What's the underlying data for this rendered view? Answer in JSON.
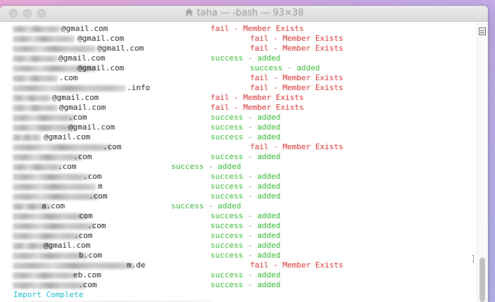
{
  "window": {
    "title": "taha — -bash — 93×38"
  },
  "terminal": {
    "rows": [
      {
        "email": "@gmail.com",
        "status": "fail - Member Exists",
        "kind": "fail"
      },
      {
        "email": "@gmail.com",
        "status": "fail - Member Exists",
        "kind": "fail"
      },
      {
        "email": "@gmail.com",
        "status": "fail - Member Exists",
        "kind": "fail"
      },
      {
        "email": "@gmail.com",
        "status": "success - added",
        "kind": "ok"
      },
      {
        "email": "@gmail.com",
        "status": "success - added",
        "kind": "ok"
      },
      {
        "email": ".com",
        "status": "fail - Member Exists",
        "kind": "fail"
      },
      {
        "email": ".info",
        "status": "fail - Member Exists",
        "kind": "fail"
      },
      {
        "email": "@gmail.com",
        "status": "fail - Member Exists",
        "kind": "fail"
      },
      {
        "email": "@gmail.com",
        "status": "fail - Member Exists",
        "kind": "fail"
      },
      {
        "email": ".com",
        "status": "success - added",
        "kind": "ok"
      },
      {
        "email": "@gmail.com",
        "status": "success - added",
        "kind": "ok"
      },
      {
        "email": "@gmail.com",
        "status": "success - added",
        "kind": "ok"
      },
      {
        "email": ".com",
        "status": "fail - Member Exists",
        "kind": "fail"
      },
      {
        "email": ".com",
        "status": "success - added",
        "kind": "ok"
      },
      {
        "email": ".com",
        "status": "success - added",
        "kind": "ok"
      },
      {
        "email": ".com",
        "status": "success - added",
        "kind": "ok"
      },
      {
        "email": "m",
        "status": "success - added",
        "kind": "ok"
      },
      {
        "email": ".com",
        "status": "success - added",
        "kind": "ok"
      },
      {
        "email": "a.com",
        "status": "success - added",
        "kind": "ok"
      },
      {
        "email": "com",
        "status": "success - added",
        "kind": "ok"
      },
      {
        "email": ".com",
        "status": "success - added",
        "kind": "ok"
      },
      {
        "email": ".com",
        "status": "success - added",
        "kind": "ok"
      },
      {
        "email": "@gmail.com",
        "status": "success - added",
        "kind": "ok"
      },
      {
        "email": "b.com",
        "status": "success - added",
        "kind": "ok"
      },
      {
        "email": "m.de",
        "status": "fail - Member Exists",
        "kind": "fail"
      },
      {
        "email": "eb.com",
        "status": "success - added",
        "kind": "ok"
      },
      {
        "email": ".com",
        "status": "success - added",
        "kind": "ok"
      }
    ],
    "complete_message": "Import Complete"
  },
  "colors": {
    "fail": "#d62b2b",
    "success": "#2fb82f",
    "complete": "#17b8c8"
  }
}
